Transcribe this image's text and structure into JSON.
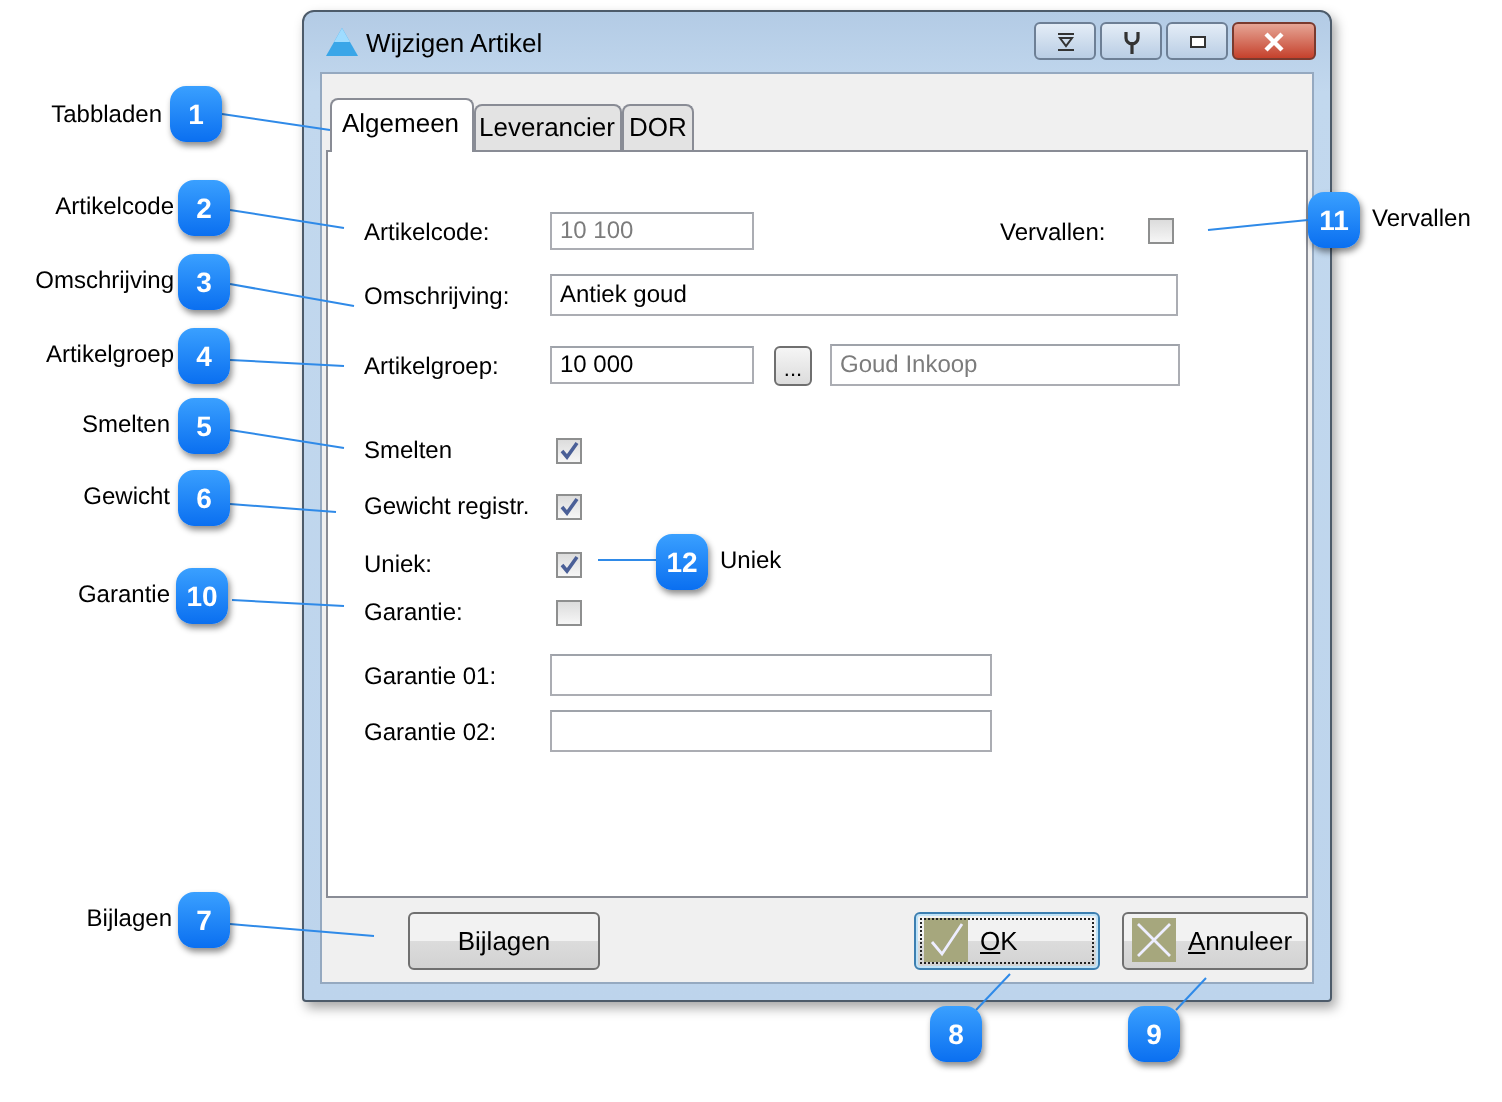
{
  "window": {
    "title": "Wijzigen Artikel"
  },
  "tabs": [
    {
      "label": "Algemeen",
      "selected": true
    },
    {
      "label": "Leverancier",
      "selected": false
    },
    {
      "label": "DOR",
      "selected": false
    }
  ],
  "fields": [
    {
      "kind": "code",
      "label": "Artikelcode:",
      "value": "10 100",
      "disabled": true
    },
    {
      "kind": "text",
      "label": "Omschrijving:",
      "value": "Antiek goud",
      "disabled": false
    },
    {
      "kind": "lookup",
      "label": "Artikelgroep:",
      "value": "10 000",
      "disabled": false,
      "button": "...",
      "description": "Goud Inkoop"
    }
  ],
  "expired": {
    "label": "Vervallen:",
    "checked": false
  },
  "options": [
    {
      "label": "Smelten",
      "checked": true
    },
    {
      "label": "Gewicht registr.",
      "checked": true
    },
    {
      "label": "Uniek:",
      "checked": true
    },
    {
      "label": "Garantie:",
      "checked": false
    }
  ],
  "guarantee_fields": [
    {
      "label": "Garantie 01:"
    },
    {
      "label": "Garantie 02:"
    }
  ],
  "buttons": [
    {
      "kind": "plain",
      "label": "Bijlagen",
      "focused": false
    },
    {
      "kind": "ok",
      "label": "OK",
      "focused": true
    },
    {
      "kind": "cancel",
      "label": "Annuleer",
      "focused": false
    }
  ],
  "callouts": [
    {
      "number": "1",
      "label": "Tabbladen"
    },
    {
      "number": "2",
      "label": "Artikelcode"
    },
    {
      "number": "3",
      "label": "Omschrijving"
    },
    {
      "number": "4",
      "label": "Artikelgroep"
    },
    {
      "number": "5",
      "label": "Smelten"
    },
    {
      "number": "6",
      "label": "Gewicht"
    },
    {
      "number": "10",
      "label": "Garantie"
    },
    {
      "number": "7",
      "label": "Bijlagen"
    },
    {
      "number": "11",
      "label": "Vervallen"
    },
    {
      "number": "12",
      "label": "Uniek"
    },
    {
      "number": "8"
    },
    {
      "number": "9"
    }
  ]
}
